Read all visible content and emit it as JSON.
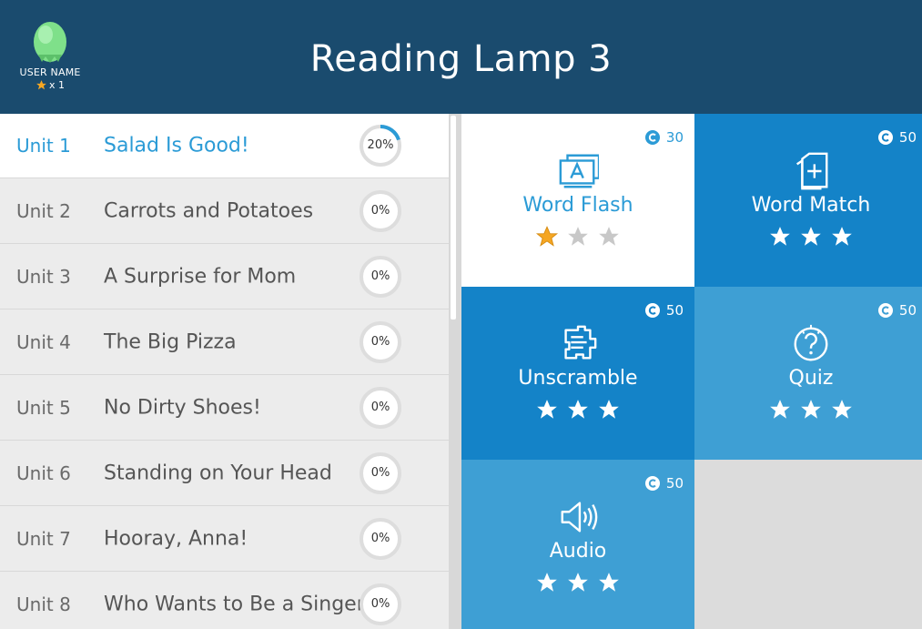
{
  "header": {
    "title": "Reading Lamp 3",
    "user_name": "USER NAME",
    "star_count": "x  1"
  },
  "units": [
    {
      "unit": "Unit 1",
      "title": "Salad Is Good!",
      "progress_label": "20%",
      "progress": 0.2,
      "active": true
    },
    {
      "unit": "Unit 2",
      "title": "Carrots and Potatoes",
      "progress_label": "0%",
      "progress": 0,
      "active": false
    },
    {
      "unit": "Unit 3",
      "title": "A Surprise for Mom",
      "progress_label": "0%",
      "progress": 0,
      "active": false
    },
    {
      "unit": "Unit 4",
      "title": "The Big Pizza",
      "progress_label": "0%",
      "progress": 0,
      "active": false
    },
    {
      "unit": "Unit 5",
      "title": "No Dirty Shoes!",
      "progress_label": "0%",
      "progress": 0,
      "active": false
    },
    {
      "unit": "Unit 6",
      "title": "Standing on Your Head",
      "progress_label": "0%",
      "progress": 0,
      "active": false
    },
    {
      "unit": "Unit 7",
      "title": "Hooray, Anna!",
      "progress_label": "0%",
      "progress": 0,
      "active": false
    },
    {
      "unit": "Unit 8",
      "title": "Who Wants to Be a Singer?",
      "progress_label": "0%",
      "progress": 0,
      "active": false
    }
  ],
  "activities": [
    {
      "name": "Word Flash",
      "coins": "30",
      "icon": "flashcard-icon",
      "stars_earned": 1,
      "stars_total": 3,
      "color": "#ffffff"
    },
    {
      "name": "Word Match",
      "coins": "50",
      "icon": "card-match-icon",
      "stars_earned": 0,
      "stars_total": 3,
      "color": "#1483c8"
    },
    {
      "name": "Unscramble",
      "coins": "50",
      "icon": "puzzle-icon",
      "stars_earned": 0,
      "stars_total": 3,
      "color": "#1483c8"
    },
    {
      "name": "Quiz",
      "coins": "50",
      "icon": "question-icon",
      "stars_earned": 0,
      "stars_total": 3,
      "color": "#3e9fd4"
    },
    {
      "name": "Audio",
      "coins": "50",
      "icon": "speaker-icon",
      "stars_earned": 0,
      "stars_total": 3,
      "color": "#3e9fd4"
    }
  ],
  "colors": {
    "header": "#1a4b6e",
    "accent": "#2b9bd6",
    "star_gold": "#f5a623",
    "star_grey": "#c8c8c8",
    "ring_track": "#dddddd",
    "ring_fill": "#2b9bd6"
  }
}
